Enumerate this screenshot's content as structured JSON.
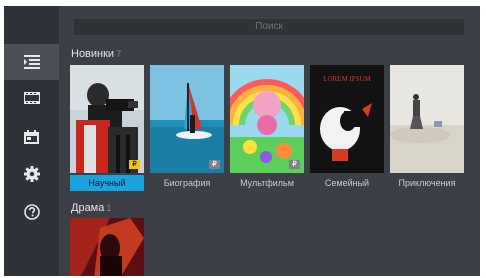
{
  "search": {
    "placeholder": "Поиск"
  },
  "sidebar": {
    "items": [
      {
        "name": "list",
        "icon": "list-icon",
        "active": true
      },
      {
        "name": "film",
        "icon": "film-strip-icon",
        "active": false
      },
      {
        "name": "calendar",
        "icon": "calendar-icon",
        "active": false
      },
      {
        "name": "settings",
        "icon": "gear-icon",
        "active": false
      },
      {
        "name": "help",
        "icon": "help-circle-icon",
        "active": false
      }
    ]
  },
  "sections": [
    {
      "title": "Новинки",
      "count": "7",
      "items": [
        {
          "label": "Научный",
          "badge": "₽",
          "badge_style": "gold",
          "selected": true
        },
        {
          "label": "Биография",
          "badge": "₽",
          "badge_style": "grey",
          "selected": false
        },
        {
          "label": "Мультфильм",
          "badge": "₽",
          "badge_style": "grey",
          "selected": false
        },
        {
          "label": "Семейный",
          "selected": false,
          "poster_text": "LOREM IPSUM"
        },
        {
          "label": "Приключения",
          "selected": false
        }
      ]
    },
    {
      "title": "Драма",
      "count": "1",
      "items": []
    }
  ],
  "colors": {
    "accent": "#1aa3dc",
    "badge_gold": "#f0c419",
    "background": "#3c4046",
    "sidebar": "#2f3238"
  }
}
